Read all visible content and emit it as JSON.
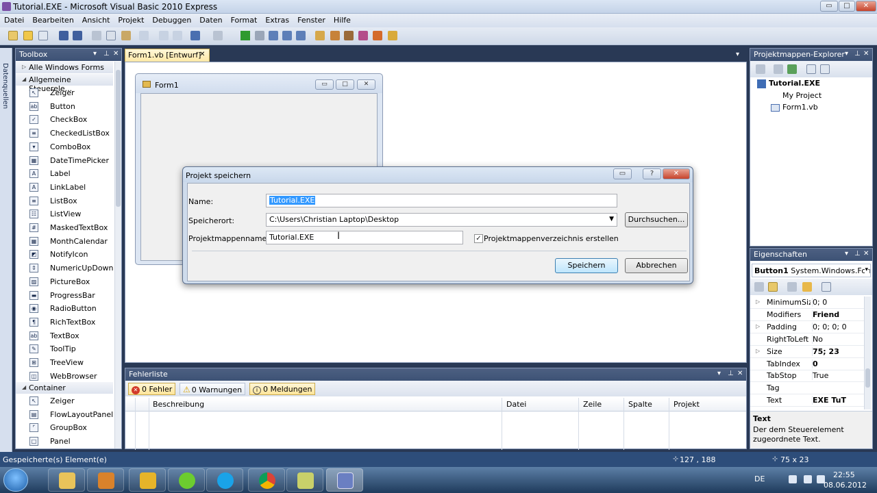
{
  "window": {
    "title": "Tutorial.EXE - Microsoft Visual Basic 2010 Express",
    "minimize": "▭",
    "maximize": "□",
    "close": "✕"
  },
  "menu": [
    "Datei",
    "Bearbeiten",
    "Ansicht",
    "Projekt",
    "Debuggen",
    "Daten",
    "Format",
    "Extras",
    "Fenster",
    "Hilfe"
  ],
  "side_tab": "Datenquellen",
  "toolbox": {
    "title": "Toolbox",
    "group_all": "Alle Windows Forms",
    "group_common": "Allgemeine Steuerele...",
    "group_container": "Container",
    "common_items": [
      {
        "label": "Zeiger",
        "icon": "↖"
      },
      {
        "label": "Button",
        "icon": "ab"
      },
      {
        "label": "CheckBox",
        "icon": "✓"
      },
      {
        "label": "CheckedListBox",
        "icon": "≡"
      },
      {
        "label": "ComboBox",
        "icon": "▾"
      },
      {
        "label": "DateTimePicker",
        "icon": "▦"
      },
      {
        "label": "Label",
        "icon": "A"
      },
      {
        "label": "LinkLabel",
        "icon": "A"
      },
      {
        "label": "ListBox",
        "icon": "≡"
      },
      {
        "label": "ListView",
        "icon": "☷"
      },
      {
        "label": "MaskedTextBox",
        "icon": "#"
      },
      {
        "label": "MonthCalendar",
        "icon": "▦"
      },
      {
        "label": "NotifyIcon",
        "icon": "◩"
      },
      {
        "label": "NumericUpDown",
        "icon": "⇕"
      },
      {
        "label": "PictureBox",
        "icon": "▨"
      },
      {
        "label": "ProgressBar",
        "icon": "▬"
      },
      {
        "label": "RadioButton",
        "icon": "◉"
      },
      {
        "label": "RichTextBox",
        "icon": "¶"
      },
      {
        "label": "TextBox",
        "icon": "ab"
      },
      {
        "label": "ToolTip",
        "icon": "✎"
      },
      {
        "label": "TreeView",
        "icon": "⊞"
      },
      {
        "label": "WebBrowser",
        "icon": "◫"
      }
    ],
    "container_items": [
      {
        "label": "Zeiger",
        "icon": "↖"
      },
      {
        "label": "FlowLayoutPanel",
        "icon": "▤"
      },
      {
        "label": "GroupBox",
        "icon": "⌜"
      },
      {
        "label": "Panel",
        "icon": "□"
      }
    ]
  },
  "document": {
    "tab": "Form1.vb [Entwurf]",
    "tab_close": "✕",
    "form_title": "Form1"
  },
  "dialog": {
    "title": "Projekt speichern",
    "name_label": "Name:",
    "name_value": "Tutorial.EXE",
    "location_label": "Speicherort:",
    "location_value": "C:\\Users\\Christian Laptop\\Desktop",
    "browse": "Durchsuchen...",
    "solution_label": "Projektmappenname:",
    "solution_value": "Tutorial.EXE",
    "create_dir": "Projektmappenverzeichnis erstellen",
    "create_dir_checked": true,
    "save": "Speichern",
    "cancel": "Abbrechen",
    "help": "?",
    "close": "✕"
  },
  "errors": {
    "title": "Fehlerliste",
    "errors": "0 Fehler",
    "warnings": "0 Warnungen",
    "messages": "0 Meldungen",
    "columns": [
      "Beschreibung",
      "Datei",
      "Zeile",
      "Spalte",
      "Projekt"
    ]
  },
  "solution": {
    "title": "Projektmappen-Explorer",
    "project": "Tutorial.EXE",
    "items": [
      "My Project",
      "Form1.vb"
    ]
  },
  "properties": {
    "title": "Eigenschaften",
    "object": "Button1",
    "object_type": "System.Windows.Form",
    "rows": [
      {
        "name": "MinimumSiz",
        "value": "0; 0",
        "expand": true,
        "bold": false
      },
      {
        "name": "Modifiers",
        "value": "Friend",
        "expand": false,
        "bold": true
      },
      {
        "name": "Padding",
        "value": "0; 0; 0; 0",
        "expand": true,
        "bold": false
      },
      {
        "name": "RightToLeft",
        "value": "No",
        "expand": false,
        "bold": false
      },
      {
        "name": "Size",
        "value": "75; 23",
        "expand": true,
        "bold": true
      },
      {
        "name": "TabIndex",
        "value": "0",
        "expand": false,
        "bold": true
      },
      {
        "name": "TabStop",
        "value": "True",
        "expand": false,
        "bold": false
      },
      {
        "name": "Tag",
        "value": "",
        "expand": false,
        "bold": false
      },
      {
        "name": "Text",
        "value": "EXE TuT",
        "expand": false,
        "bold": true
      }
    ],
    "desc_title": "Text",
    "desc_text": "Der dem Steuerelement zugeordnete Text."
  },
  "status": {
    "message": "Gespeicherte(s) Element(e)",
    "position": "127 , 188",
    "size": "75 x 23"
  },
  "tray": {
    "lang": "DE",
    "time": "22:55",
    "date": "08.06.2012"
  }
}
